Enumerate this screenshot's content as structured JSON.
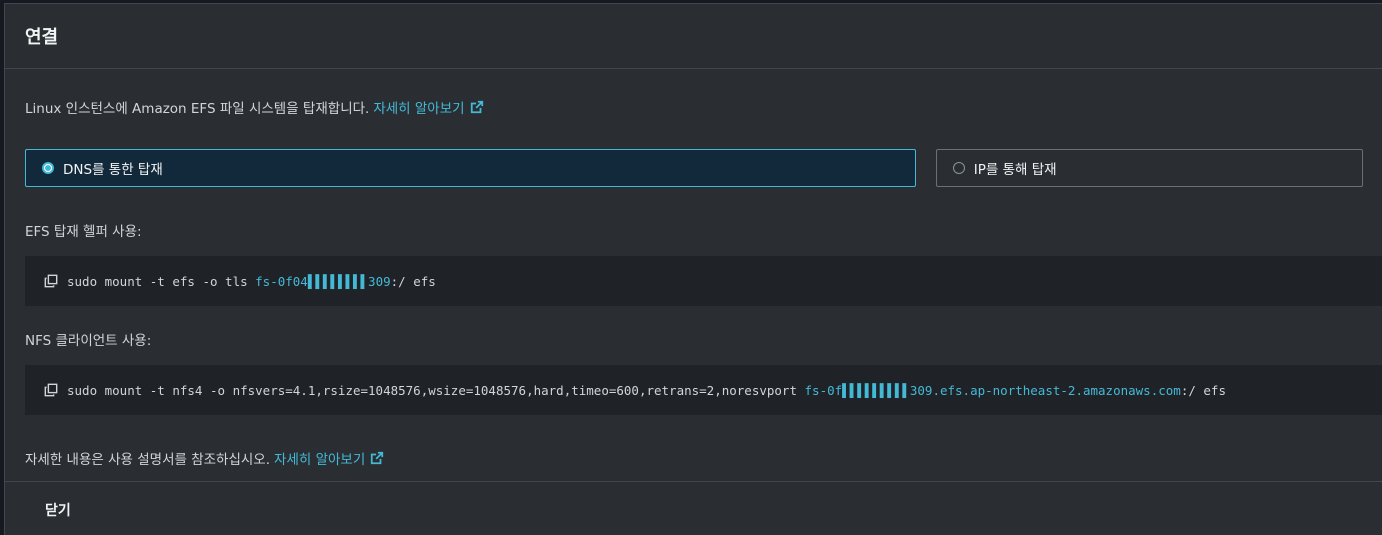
{
  "modal": {
    "title": "연결",
    "intro_text": "Linux 인스턴스에 Amazon EFS 파일 시스템을 탑재합니다.",
    "intro_link": "자세히 알아보기",
    "mount_options": [
      {
        "label": "DNS를 통한 탑재",
        "selected": true
      },
      {
        "label": "IP를 통해 탑재",
        "selected": false
      }
    ],
    "efs_helper_label": "EFS 탑재 헬퍼 사용:",
    "efs_helper_cmd_prefix": "sudo mount -t efs -o tls ",
    "efs_helper_cmd_id": "fs-0f04▌▌▌▌▌▌▌▌309",
    "efs_helper_cmd_suffix": ":/ efs",
    "nfs_label": "NFS 클라이언트 사용:",
    "nfs_cmd_prefix": "sudo mount -t nfs4 -o nfsvers=4.1,rsize=1048576,wsize=1048576,hard,timeo=600,retrans=2,noresvport ",
    "nfs_cmd_id": "fs-0f▌▌▌▌▌▌▌▌▌309.efs.ap-northeast-2.amazonaws.com",
    "nfs_cmd_suffix": ":/ efs",
    "footer_note_text": "자세한 내용은 사용 설명서를 참조하십시오.",
    "footer_note_link": "자세히 알아보기",
    "close_label": "닫기"
  },
  "colors": {
    "accent": "#44b9d6",
    "modal_bg": "#2a2e33",
    "selected_bg": "#12293b"
  },
  "icons": {
    "external": "external-link-icon",
    "copy": "copy-icon"
  }
}
